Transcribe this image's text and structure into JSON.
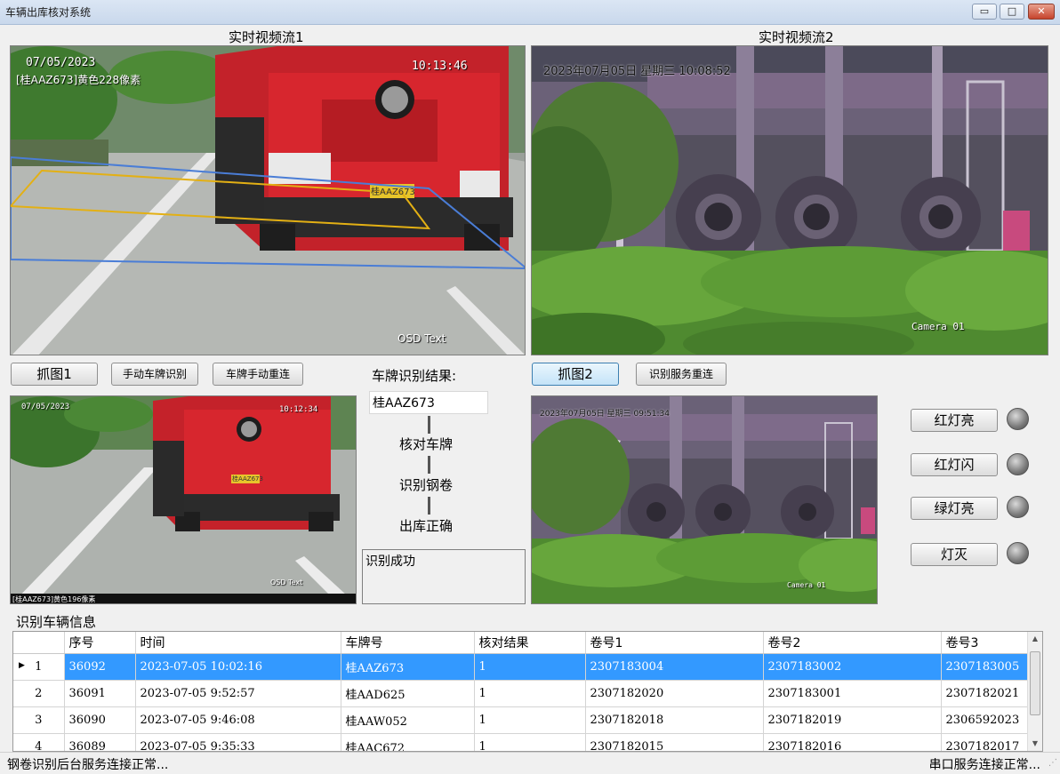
{
  "window": {
    "title": "车辆出库核对系统",
    "minimize": "▭",
    "maximize": "□",
    "close": "✕"
  },
  "stream1": {
    "caption": "实时视频流1",
    "osd_date": "07/05/2023",
    "osd_time": "10:13:46",
    "osd_plate": "[桂AAZ673]黄色228像素",
    "osd_text": "OSD Text",
    "plate_text": "桂AAZ673"
  },
  "stream2": {
    "caption": "实时视频流2",
    "osd_datetime": "2023年07月05日  星期三  10:08:52",
    "osd_camera": "Camera 01"
  },
  "snapshot1": {
    "osd_date": "07/05/2023",
    "osd_time": "10:12:34",
    "osd_plate": "[桂AAZ673]黄色196像素",
    "osd_text": "OSD Text",
    "plate_text": "桂AAZ673"
  },
  "snapshot2": {
    "osd_datetime": "2023年07月05日  星期三  09:51:34",
    "osd_camera": "Camera 01"
  },
  "buttons": {
    "capture1": "抓图1",
    "manual_recognize": "手动车牌识别",
    "manual_reconnect": "车牌手动重连",
    "capture2": "抓图2",
    "service_reconnect": "识别服务重连"
  },
  "recognition": {
    "result_label": "车牌识别结果:",
    "plate_value": "桂AAZ673",
    "step1": "核对车牌",
    "step2": "识别钢卷",
    "step3": "出库正确",
    "message": "识别成功"
  },
  "lights": {
    "red_on": "红灯亮",
    "red_flash": "红灯闪",
    "green_on": "绿灯亮",
    "off": "灯灭"
  },
  "table": {
    "group_title": "识别车辆信息",
    "columns": [
      "序号",
      "时间",
      "车牌号",
      "核对结果",
      "卷号1",
      "卷号2",
      "卷号3"
    ],
    "rows": [
      {
        "row_num": "1",
        "seq": "36092",
        "time": "2023-07-05 10:02:16",
        "plate": "桂AAZ673",
        "check": "1",
        "coil1": "2307183004",
        "coil2": "2307183002",
        "coil3": "2307183005"
      },
      {
        "row_num": "2",
        "seq": "36091",
        "time": "2023-07-05 9:52:57",
        "plate": "桂AAD625",
        "check": "1",
        "coil1": "2307182020",
        "coil2": "2307183001",
        "coil3": "2307182021"
      },
      {
        "row_num": "3",
        "seq": "36090",
        "time": "2023-07-05 9:46:08",
        "plate": "桂AAW052",
        "check": "1",
        "coil1": "2307182018",
        "coil2": "2307182019",
        "coil3": "2306592023"
      },
      {
        "row_num": "4",
        "seq": "36089",
        "time": "2023-07-05 9:35:33",
        "plate": "桂AAC672",
        "check": "1",
        "coil1": "2307182015",
        "coil2": "2307182016",
        "coil3": "2307182017"
      }
    ],
    "selected_row": 0
  },
  "status": {
    "left": "钢卷识别后台服务连接正常...",
    "right": "串口服务连接正常..."
  }
}
